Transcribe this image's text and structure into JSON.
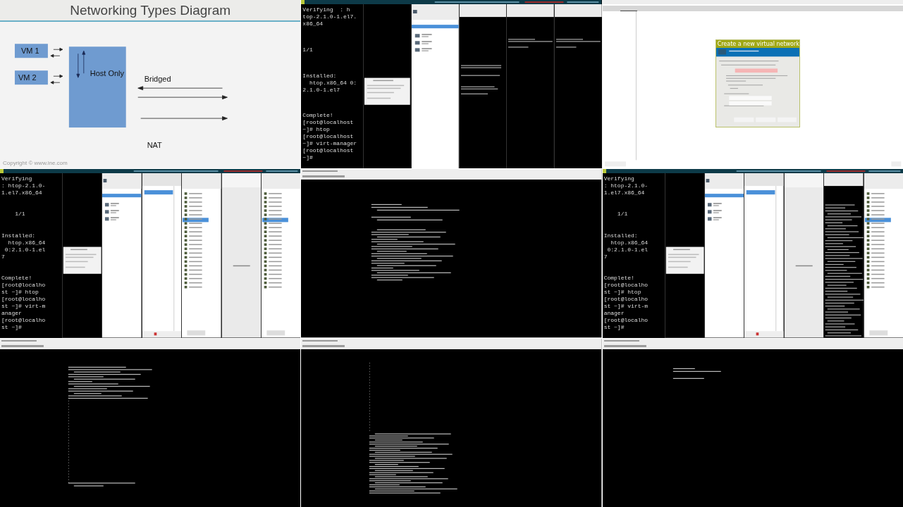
{
  "frames": [
    {
      "kind": "slide",
      "title": "Networking Types Diagram",
      "labels": [
        "VM 1",
        "VM 2",
        "Host Only",
        "Bridged",
        "NAT"
      ],
      "footer": "Copyright © www.ine.com"
    },
    {
      "kind": "desktop",
      "terminal": [
        [
          "Verifying  : h",
          "top-2.1.0-1.el7.",
          "x86_64"
        ],
        [
          "1/1"
        ],
        [
          "Installed:",
          "  htop.x86_64 0:",
          "2.1.0-1.el7"
        ],
        [
          "Complete!",
          "[root@localhost",
          "~]# htop",
          "[root@localhost",
          "~]# virt-manager",
          "[root@localhost",
          "~]#"
        ]
      ],
      "panes": [
        {
          "kind": "black-dialog"
        },
        {
          "kind": "vm-list"
        },
        {
          "kind": "console-boot"
        },
        {
          "kind": "console-login"
        },
        {
          "kind": "console-login"
        }
      ]
    },
    {
      "kind": "dialog",
      "title": "Create a new virtual network"
    },
    {
      "kind": "desktop",
      "terminal": [
        [
          "Verifying",
          ": htop-2.1.0-",
          "1.el7.x86_64"
        ],
        [
          "    1/1"
        ],
        [
          "Installed:",
          "  htop.x86_64",
          " 0:2.1.0-1.el",
          "7"
        ],
        [
          "Complete!",
          "[root@localho",
          "st ~]# htop",
          "[root@localho",
          "st ~]# virt-m",
          "anager",
          "[root@localho",
          "st ~]#"
        ]
      ],
      "panes": [
        {
          "kind": "black-dialog"
        },
        {
          "kind": "vm-list"
        },
        {
          "kind": "net-list"
        },
        {
          "kind": "hardware-list"
        },
        {
          "kind": "blank"
        },
        {
          "kind": "hardware-list"
        }
      ]
    },
    {
      "kind": "console",
      "screen": {
        "kind": "ip-output"
      }
    },
    {
      "kind": "desktop",
      "terminal": [
        [
          "Verifying",
          ": htop-2.1.0-",
          "1.el7.x86_64"
        ],
        [
          "    1/1"
        ],
        [
          "Installed:",
          "  htop.x86_64",
          " 0:2.1.0-1.el",
          "7"
        ],
        [
          "Complete!",
          "[root@localho",
          "st ~]# htop",
          "[root@localho",
          "st ~]# virt-m",
          "anager",
          "[root@localho",
          "st ~]#"
        ]
      ],
      "panes": [
        {
          "kind": "black-dialog"
        },
        {
          "kind": "vm-list"
        },
        {
          "kind": "net-list"
        },
        {
          "kind": "blank"
        },
        {
          "kind": "console-text"
        },
        {
          "kind": "hardware-list"
        }
      ]
    },
    {
      "kind": "console",
      "screen": {
        "kind": "ifcfg"
      }
    },
    {
      "kind": "console",
      "screen": {
        "kind": "ip-long"
      }
    },
    {
      "kind": "console",
      "screen": {
        "kind": "login"
      }
    }
  ]
}
